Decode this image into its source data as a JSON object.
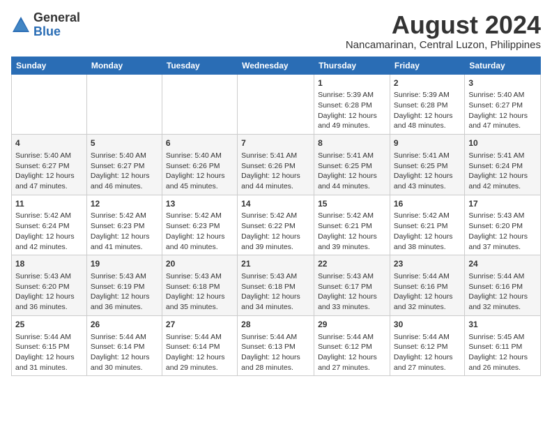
{
  "header": {
    "logo": {
      "text_general": "General",
      "text_blue": "Blue"
    },
    "title": "August 2024",
    "subtitle": "Nancamarinan, Central Luzon, Philippines"
  },
  "days_of_week": [
    "Sunday",
    "Monday",
    "Tuesday",
    "Wednesday",
    "Thursday",
    "Friday",
    "Saturday"
  ],
  "weeks": [
    [
      {
        "day": "",
        "sunrise": "",
        "sunset": "",
        "daylight": ""
      },
      {
        "day": "",
        "sunrise": "",
        "sunset": "",
        "daylight": ""
      },
      {
        "day": "",
        "sunrise": "",
        "sunset": "",
        "daylight": ""
      },
      {
        "day": "",
        "sunrise": "",
        "sunset": "",
        "daylight": ""
      },
      {
        "day": "1",
        "sunrise": "Sunrise: 5:39 AM",
        "sunset": "Sunset: 6:28 PM",
        "daylight": "Daylight: 12 hours and 49 minutes."
      },
      {
        "day": "2",
        "sunrise": "Sunrise: 5:39 AM",
        "sunset": "Sunset: 6:28 PM",
        "daylight": "Daylight: 12 hours and 48 minutes."
      },
      {
        "day": "3",
        "sunrise": "Sunrise: 5:40 AM",
        "sunset": "Sunset: 6:27 PM",
        "daylight": "Daylight: 12 hours and 47 minutes."
      }
    ],
    [
      {
        "day": "4",
        "sunrise": "Sunrise: 5:40 AM",
        "sunset": "Sunset: 6:27 PM",
        "daylight": "Daylight: 12 hours and 47 minutes."
      },
      {
        "day": "5",
        "sunrise": "Sunrise: 5:40 AM",
        "sunset": "Sunset: 6:27 PM",
        "daylight": "Daylight: 12 hours and 46 minutes."
      },
      {
        "day": "6",
        "sunrise": "Sunrise: 5:40 AM",
        "sunset": "Sunset: 6:26 PM",
        "daylight": "Daylight: 12 hours and 45 minutes."
      },
      {
        "day": "7",
        "sunrise": "Sunrise: 5:41 AM",
        "sunset": "Sunset: 6:26 PM",
        "daylight": "Daylight: 12 hours and 44 minutes."
      },
      {
        "day": "8",
        "sunrise": "Sunrise: 5:41 AM",
        "sunset": "Sunset: 6:25 PM",
        "daylight": "Daylight: 12 hours and 44 minutes."
      },
      {
        "day": "9",
        "sunrise": "Sunrise: 5:41 AM",
        "sunset": "Sunset: 6:25 PM",
        "daylight": "Daylight: 12 hours and 43 minutes."
      },
      {
        "day": "10",
        "sunrise": "Sunrise: 5:41 AM",
        "sunset": "Sunset: 6:24 PM",
        "daylight": "Daylight: 12 hours and 42 minutes."
      }
    ],
    [
      {
        "day": "11",
        "sunrise": "Sunrise: 5:42 AM",
        "sunset": "Sunset: 6:24 PM",
        "daylight": "Daylight: 12 hours and 42 minutes."
      },
      {
        "day": "12",
        "sunrise": "Sunrise: 5:42 AM",
        "sunset": "Sunset: 6:23 PM",
        "daylight": "Daylight: 12 hours and 41 minutes."
      },
      {
        "day": "13",
        "sunrise": "Sunrise: 5:42 AM",
        "sunset": "Sunset: 6:23 PM",
        "daylight": "Daylight: 12 hours and 40 minutes."
      },
      {
        "day": "14",
        "sunrise": "Sunrise: 5:42 AM",
        "sunset": "Sunset: 6:22 PM",
        "daylight": "Daylight: 12 hours and 39 minutes."
      },
      {
        "day": "15",
        "sunrise": "Sunrise: 5:42 AM",
        "sunset": "Sunset: 6:21 PM",
        "daylight": "Daylight: 12 hours and 39 minutes."
      },
      {
        "day": "16",
        "sunrise": "Sunrise: 5:42 AM",
        "sunset": "Sunset: 6:21 PM",
        "daylight": "Daylight: 12 hours and 38 minutes."
      },
      {
        "day": "17",
        "sunrise": "Sunrise: 5:43 AM",
        "sunset": "Sunset: 6:20 PM",
        "daylight": "Daylight: 12 hours and 37 minutes."
      }
    ],
    [
      {
        "day": "18",
        "sunrise": "Sunrise: 5:43 AM",
        "sunset": "Sunset: 6:20 PM",
        "daylight": "Daylight: 12 hours and 36 minutes."
      },
      {
        "day": "19",
        "sunrise": "Sunrise: 5:43 AM",
        "sunset": "Sunset: 6:19 PM",
        "daylight": "Daylight: 12 hours and 36 minutes."
      },
      {
        "day": "20",
        "sunrise": "Sunrise: 5:43 AM",
        "sunset": "Sunset: 6:18 PM",
        "daylight": "Daylight: 12 hours and 35 minutes."
      },
      {
        "day": "21",
        "sunrise": "Sunrise: 5:43 AM",
        "sunset": "Sunset: 6:18 PM",
        "daylight": "Daylight: 12 hours and 34 minutes."
      },
      {
        "day": "22",
        "sunrise": "Sunrise: 5:43 AM",
        "sunset": "Sunset: 6:17 PM",
        "daylight": "Daylight: 12 hours and 33 minutes."
      },
      {
        "day": "23",
        "sunrise": "Sunrise: 5:44 AM",
        "sunset": "Sunset: 6:16 PM",
        "daylight": "Daylight: 12 hours and 32 minutes."
      },
      {
        "day": "24",
        "sunrise": "Sunrise: 5:44 AM",
        "sunset": "Sunset: 6:16 PM",
        "daylight": "Daylight: 12 hours and 32 minutes."
      }
    ],
    [
      {
        "day": "25",
        "sunrise": "Sunrise: 5:44 AM",
        "sunset": "Sunset: 6:15 PM",
        "daylight": "Daylight: 12 hours and 31 minutes."
      },
      {
        "day": "26",
        "sunrise": "Sunrise: 5:44 AM",
        "sunset": "Sunset: 6:14 PM",
        "daylight": "Daylight: 12 hours and 30 minutes."
      },
      {
        "day": "27",
        "sunrise": "Sunrise: 5:44 AM",
        "sunset": "Sunset: 6:14 PM",
        "daylight": "Daylight: 12 hours and 29 minutes."
      },
      {
        "day": "28",
        "sunrise": "Sunrise: 5:44 AM",
        "sunset": "Sunset: 6:13 PM",
        "daylight": "Daylight: 12 hours and 28 minutes."
      },
      {
        "day": "29",
        "sunrise": "Sunrise: 5:44 AM",
        "sunset": "Sunset: 6:12 PM",
        "daylight": "Daylight: 12 hours and 27 minutes."
      },
      {
        "day": "30",
        "sunrise": "Sunrise: 5:44 AM",
        "sunset": "Sunset: 6:12 PM",
        "daylight": "Daylight: 12 hours and 27 minutes."
      },
      {
        "day": "31",
        "sunrise": "Sunrise: 5:45 AM",
        "sunset": "Sunset: 6:11 PM",
        "daylight": "Daylight: 12 hours and 26 minutes."
      }
    ]
  ]
}
